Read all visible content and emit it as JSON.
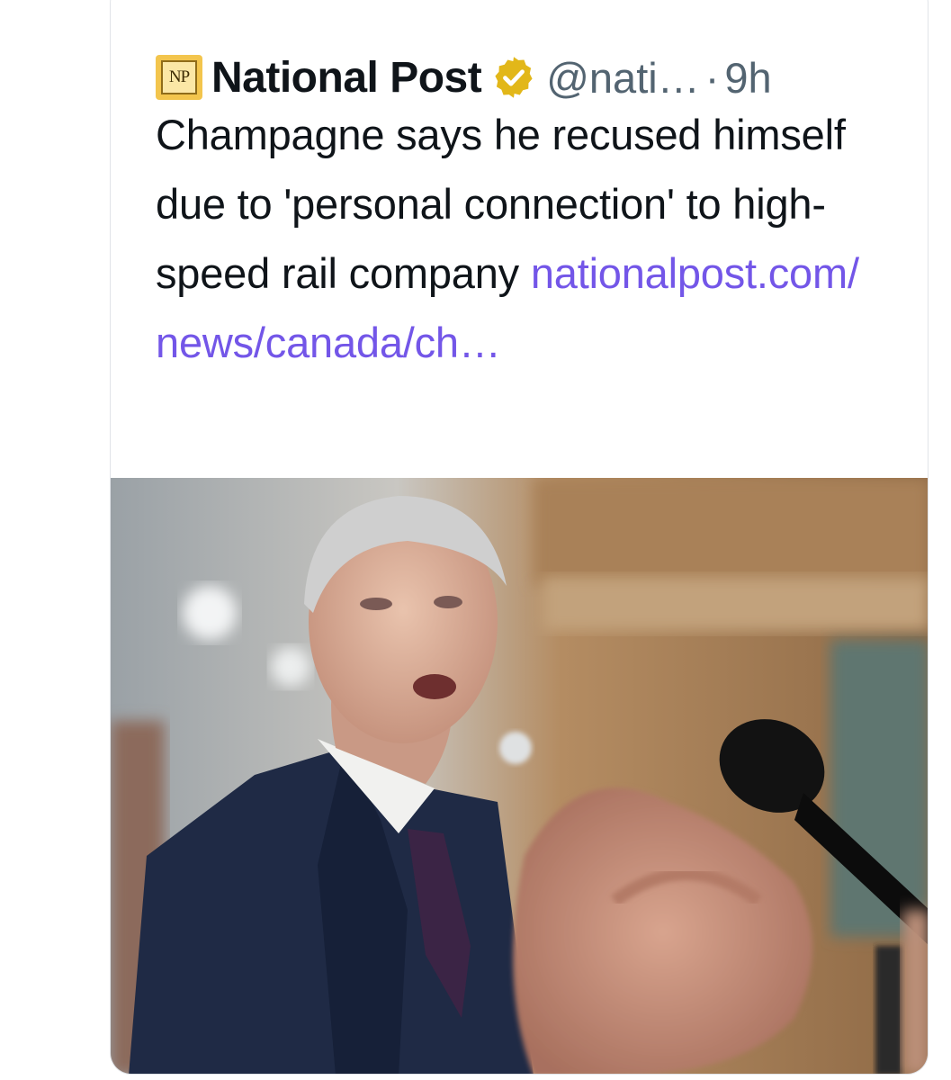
{
  "tweet": {
    "account_name": "National Post",
    "logo_text": "NP",
    "handle": "@nati…",
    "separator": "·",
    "time": "9h",
    "verified_icon": "verified-badge-icon",
    "text": "Champagne says he recused himself due to 'personal connection' to high-speed rail company",
    "link_text": "nationalpost.com/ news/canada/ch…"
  },
  "colors": {
    "logo_gold": "#f3c54d",
    "badge_gold": "#e2b719",
    "link": "#7356e8",
    "text": "#0f1419",
    "muted": "#536471"
  },
  "image": {
    "description_icon": "news-photo"
  }
}
